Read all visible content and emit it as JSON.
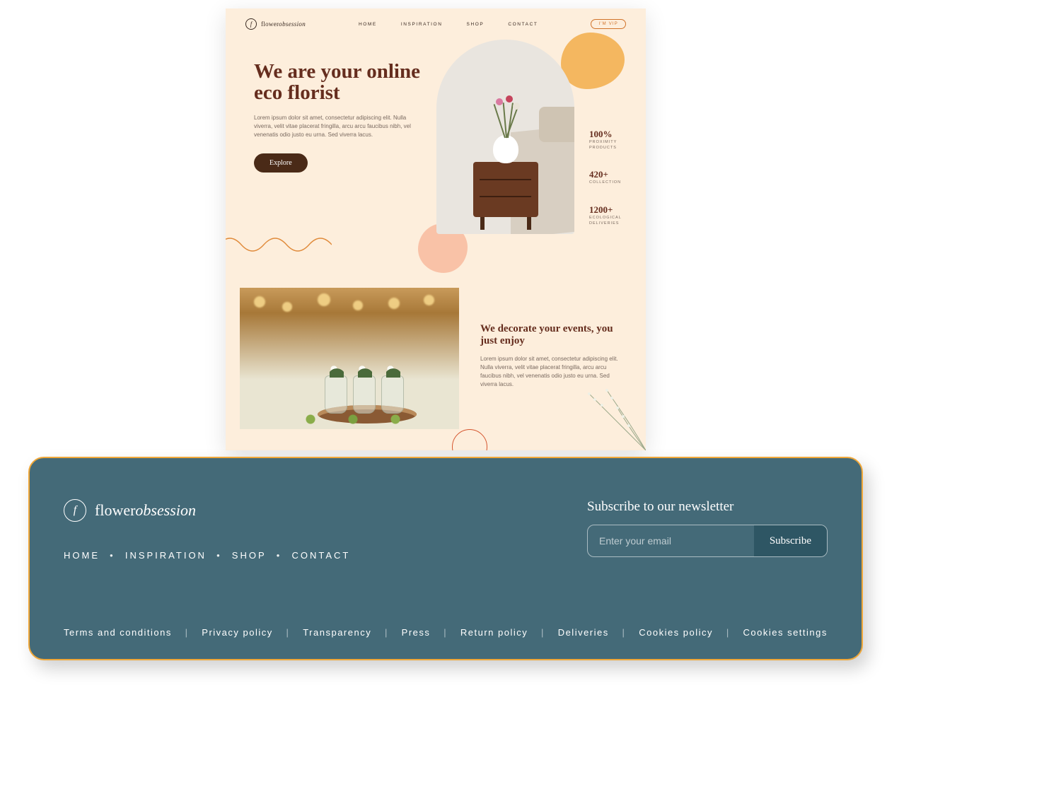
{
  "brand": {
    "name_a": "flower",
    "name_b": "obsession",
    "mark": "f"
  },
  "nav": {
    "items": [
      "HOME",
      "INSPIRATION",
      "SHOP",
      "CONTACT"
    ],
    "vip_label": "I'M VIP"
  },
  "hero": {
    "title": "We are your online eco florist",
    "body": "Lorem ipsum dolor sit amet, consectetur adipiscing elit. Nulla viverra, velit vitae placerat fringilla, arcu arcu faucibus nibh, vel venenatis odio justo eu urna. Sed viverra lacus.",
    "cta": "Explore"
  },
  "stats": [
    {
      "value": "100%",
      "label": "PROXIMITY PRODUCTS"
    },
    {
      "value": "420+",
      "label": "COLLECTION"
    },
    {
      "value": "1200+",
      "label": "ECOLOGICAL DELIVERIES"
    }
  ],
  "events": {
    "title": "We decorate your events, you just enjoy",
    "body": "Lorem ipsum dolor sit amet, consectetur adipiscing elit. Nulla viverra, velit vitae placerat fringilla, arcu arcu faucibus nibh, vel venenatis odio justo eu urna. Sed viverra lacus."
  },
  "footer": {
    "nav": [
      "HOME",
      "INSPIRATION",
      "SHOP",
      "CONTACT"
    ],
    "newsletter": {
      "title": "Subscribe to our newsletter",
      "placeholder": "Enter your email",
      "button": "Subscribe"
    },
    "legal": [
      "Terms and conditions",
      "Privacy policy",
      "Transparency",
      "Press",
      "Return policy",
      "Deliveries",
      "Cookies policy",
      "Cookies settings"
    ]
  }
}
